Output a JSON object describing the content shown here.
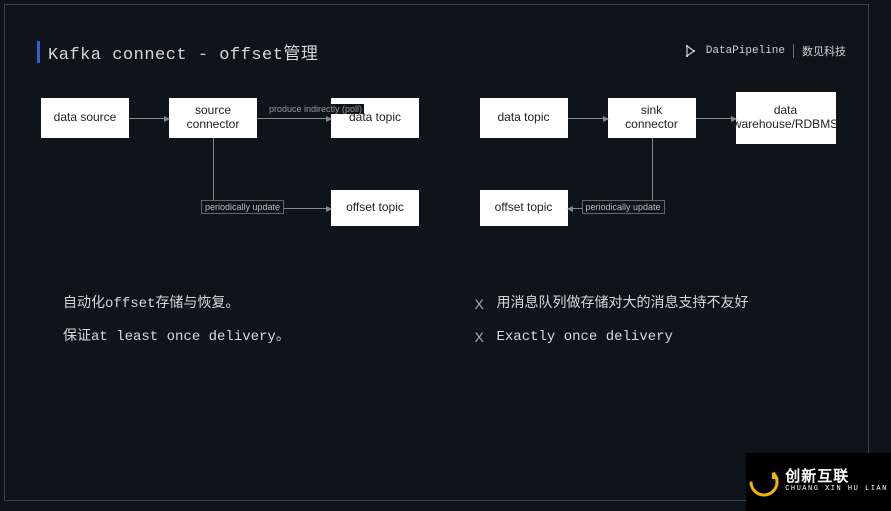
{
  "title": "Kafka connect - offset管理",
  "brand": {
    "name": "DataPipeline",
    "tagline": "数见科技"
  },
  "diagram_left": {
    "nodes": {
      "src": "data source",
      "conn": "source connector",
      "topic": "data topic",
      "off": "offset topic"
    },
    "edges": {
      "produce": "produce indirectly (poll)",
      "periodic": "periodically update"
    }
  },
  "diagram_right": {
    "nodes": {
      "topic": "data topic",
      "conn": "sink connector",
      "sink": "data warehouse/RDBMS",
      "off": "offset topic"
    },
    "edges": {
      "periodic": "periodically update"
    }
  },
  "bullets_left": [
    {
      "mark": "",
      "text": "自动化offset存储与恢复。"
    },
    {
      "mark": "",
      "text": "保证at least once delivery。"
    }
  ],
  "bullets_right": [
    {
      "mark": "X",
      "text": "用消息队列做存储对大的消息支持不友好"
    },
    {
      "mark": "X",
      "text": "Exactly once delivery"
    }
  ],
  "watermark": {
    "zh": "创新互联",
    "py": "CHUANG XIN HU LIAN"
  }
}
